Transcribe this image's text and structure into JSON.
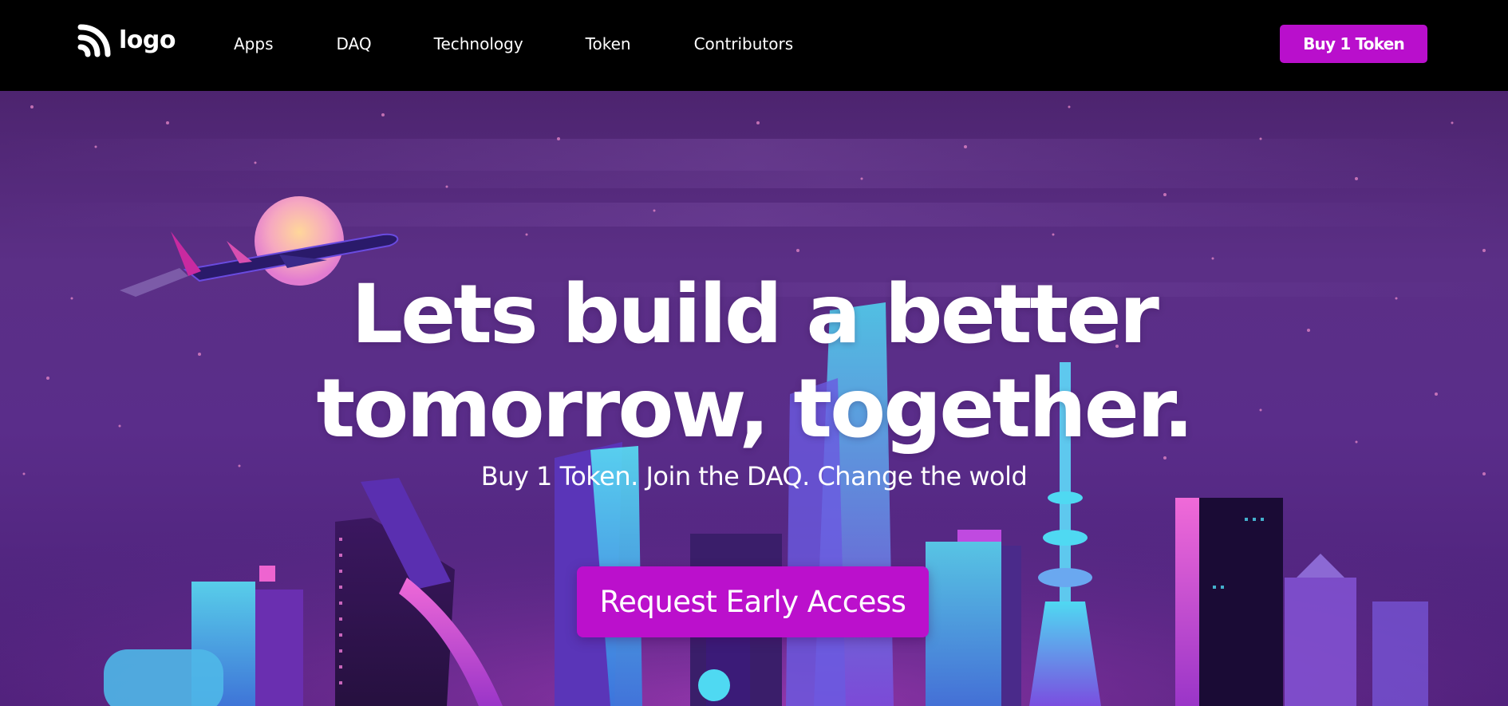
{
  "brand": {
    "name": "logo",
    "icon": "rss-feed-icon"
  },
  "nav": {
    "items": [
      {
        "label": "Apps"
      },
      {
        "label": "DAQ"
      },
      {
        "label": "Technology"
      },
      {
        "label": "Token"
      },
      {
        "label": "Contributors"
      }
    ]
  },
  "header": {
    "buy_label": "Buy 1 Token"
  },
  "hero": {
    "headline_line1": "Lets build a better",
    "headline_line2": "tomorrow, together.",
    "subheadline": "Buy 1 Token. Join the DAQ. Change the wold",
    "cta_label": "Request Early Access"
  },
  "colors": {
    "header_bg": "#000000",
    "accent": "#b90fcc",
    "sky_top": "#4d246f",
    "sky_mid": "#5b2f86",
    "neon_cyan": "#34d4f0",
    "neon_pink": "#e04ad0"
  }
}
